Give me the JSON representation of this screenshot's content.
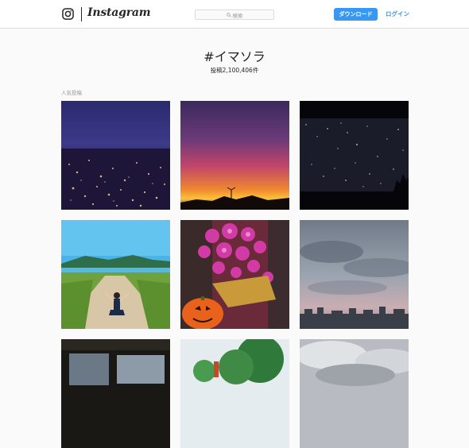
{
  "header": {
    "logo_text": "Instagram",
    "search_placeholder": "検索",
    "download_label": "ダウンロード",
    "login_label": "ログイン"
  },
  "hashtag": {
    "title": "#イマソラ",
    "post_count": "投稿2,100,406件"
  },
  "section": {
    "label": "人気投稿"
  },
  "colors": {
    "accent": "#3897f0",
    "background": "#fafafa",
    "text": "#262626",
    "muted": "#999999"
  },
  "posts": [
    {
      "subject": "night city lights"
    },
    {
      "subject": "sunset silhouette"
    },
    {
      "subject": "starry night sky"
    },
    {
      "subject": "person on beach road"
    },
    {
      "subject": "orchids and pumpkin"
    },
    {
      "subject": "cloudy sky over city"
    },
    {
      "subject": "dark interior"
    },
    {
      "subject": "green trees"
    },
    {
      "subject": "grey clouds"
    }
  ]
}
